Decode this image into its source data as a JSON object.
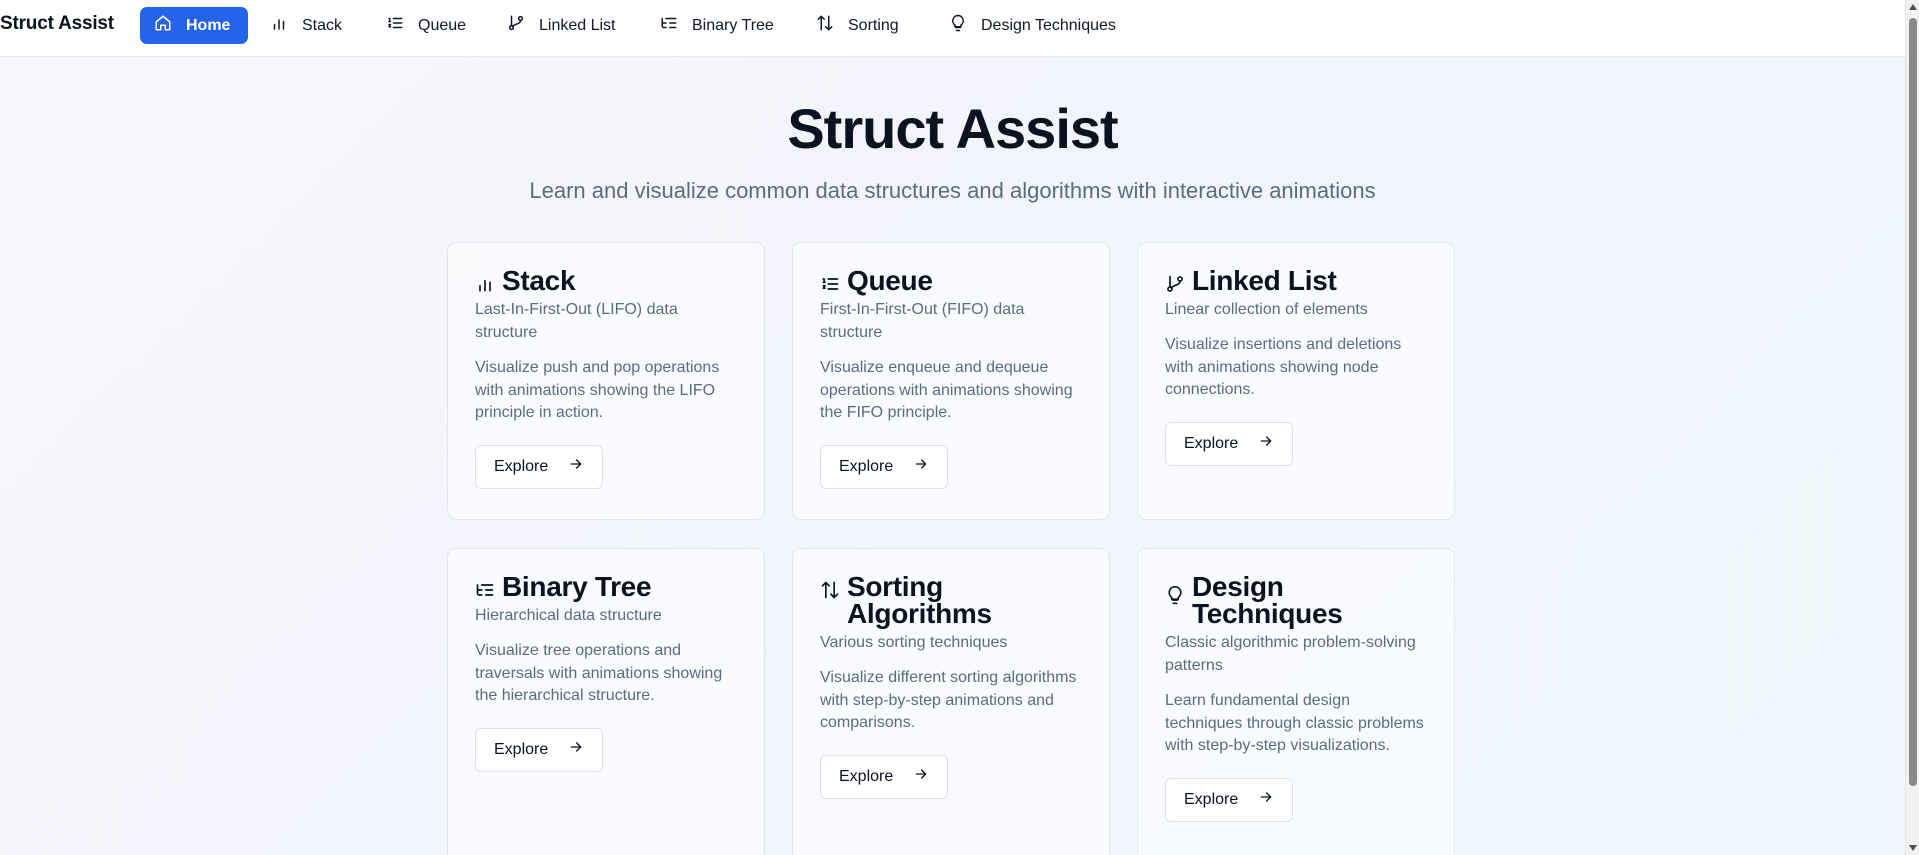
{
  "brand": "Struct Assist",
  "nav": [
    {
      "label": "Home",
      "icon": "home-icon",
      "active": true
    },
    {
      "label": "Stack",
      "icon": "bar-chart-icon"
    },
    {
      "label": "Queue",
      "icon": "list-ordered-icon"
    },
    {
      "label": "Linked List",
      "icon": "git-branch-icon"
    },
    {
      "label": "Binary Tree",
      "icon": "list-tree-icon"
    },
    {
      "label": "Sorting",
      "icon": "arrow-up-down-icon"
    },
    {
      "label": "Design Techniques",
      "icon": "lightbulb-icon"
    }
  ],
  "hero": {
    "title": "Struct Assist",
    "subtitle": "Learn and visualize common data structures and algorithms with interactive animations"
  },
  "cards": [
    {
      "title": "Stack",
      "icon": "bar-chart-icon",
      "tagline": "Last-In-First-Out (LIFO) data structure",
      "description": "Visualize push and pop operations with animations showing the LIFO principle in action.",
      "button": "Explore"
    },
    {
      "title": "Queue",
      "icon": "list-ordered-icon",
      "tagline": "First-In-First-Out (FIFO) data structure",
      "description": "Visualize enqueue and dequeue operations with animations showing the FIFO principle.",
      "button": "Explore"
    },
    {
      "title": "Linked List",
      "icon": "git-branch-icon",
      "tagline": "Linear collection of elements",
      "description": "Visualize insertions and deletions with animations showing node connections.",
      "button": "Explore"
    },
    {
      "title": "Binary Tree",
      "icon": "list-tree-icon",
      "tagline": "Hierarchical data structure",
      "description": "Visualize tree operations and traversals with animations showing the hierarchical structure.",
      "button": "Explore"
    },
    {
      "title": "Sorting Algorithms",
      "icon": "arrow-up-down-icon",
      "tagline": "Various sorting techniques",
      "description": "Visualize different sorting algorithms with step-by-step animations and comparisons.",
      "button": "Explore"
    },
    {
      "title": "Design Techniques",
      "icon": "lightbulb-icon",
      "tagline": "Classic algorithmic problem-solving patterns",
      "description": "Learn fundamental design techniques through classic problems with step-by-step visualizations.",
      "button": "Explore"
    }
  ],
  "colors": {
    "accent": "#2563eb",
    "muted_text": "#5b6b82",
    "heading": "#0b1220"
  }
}
